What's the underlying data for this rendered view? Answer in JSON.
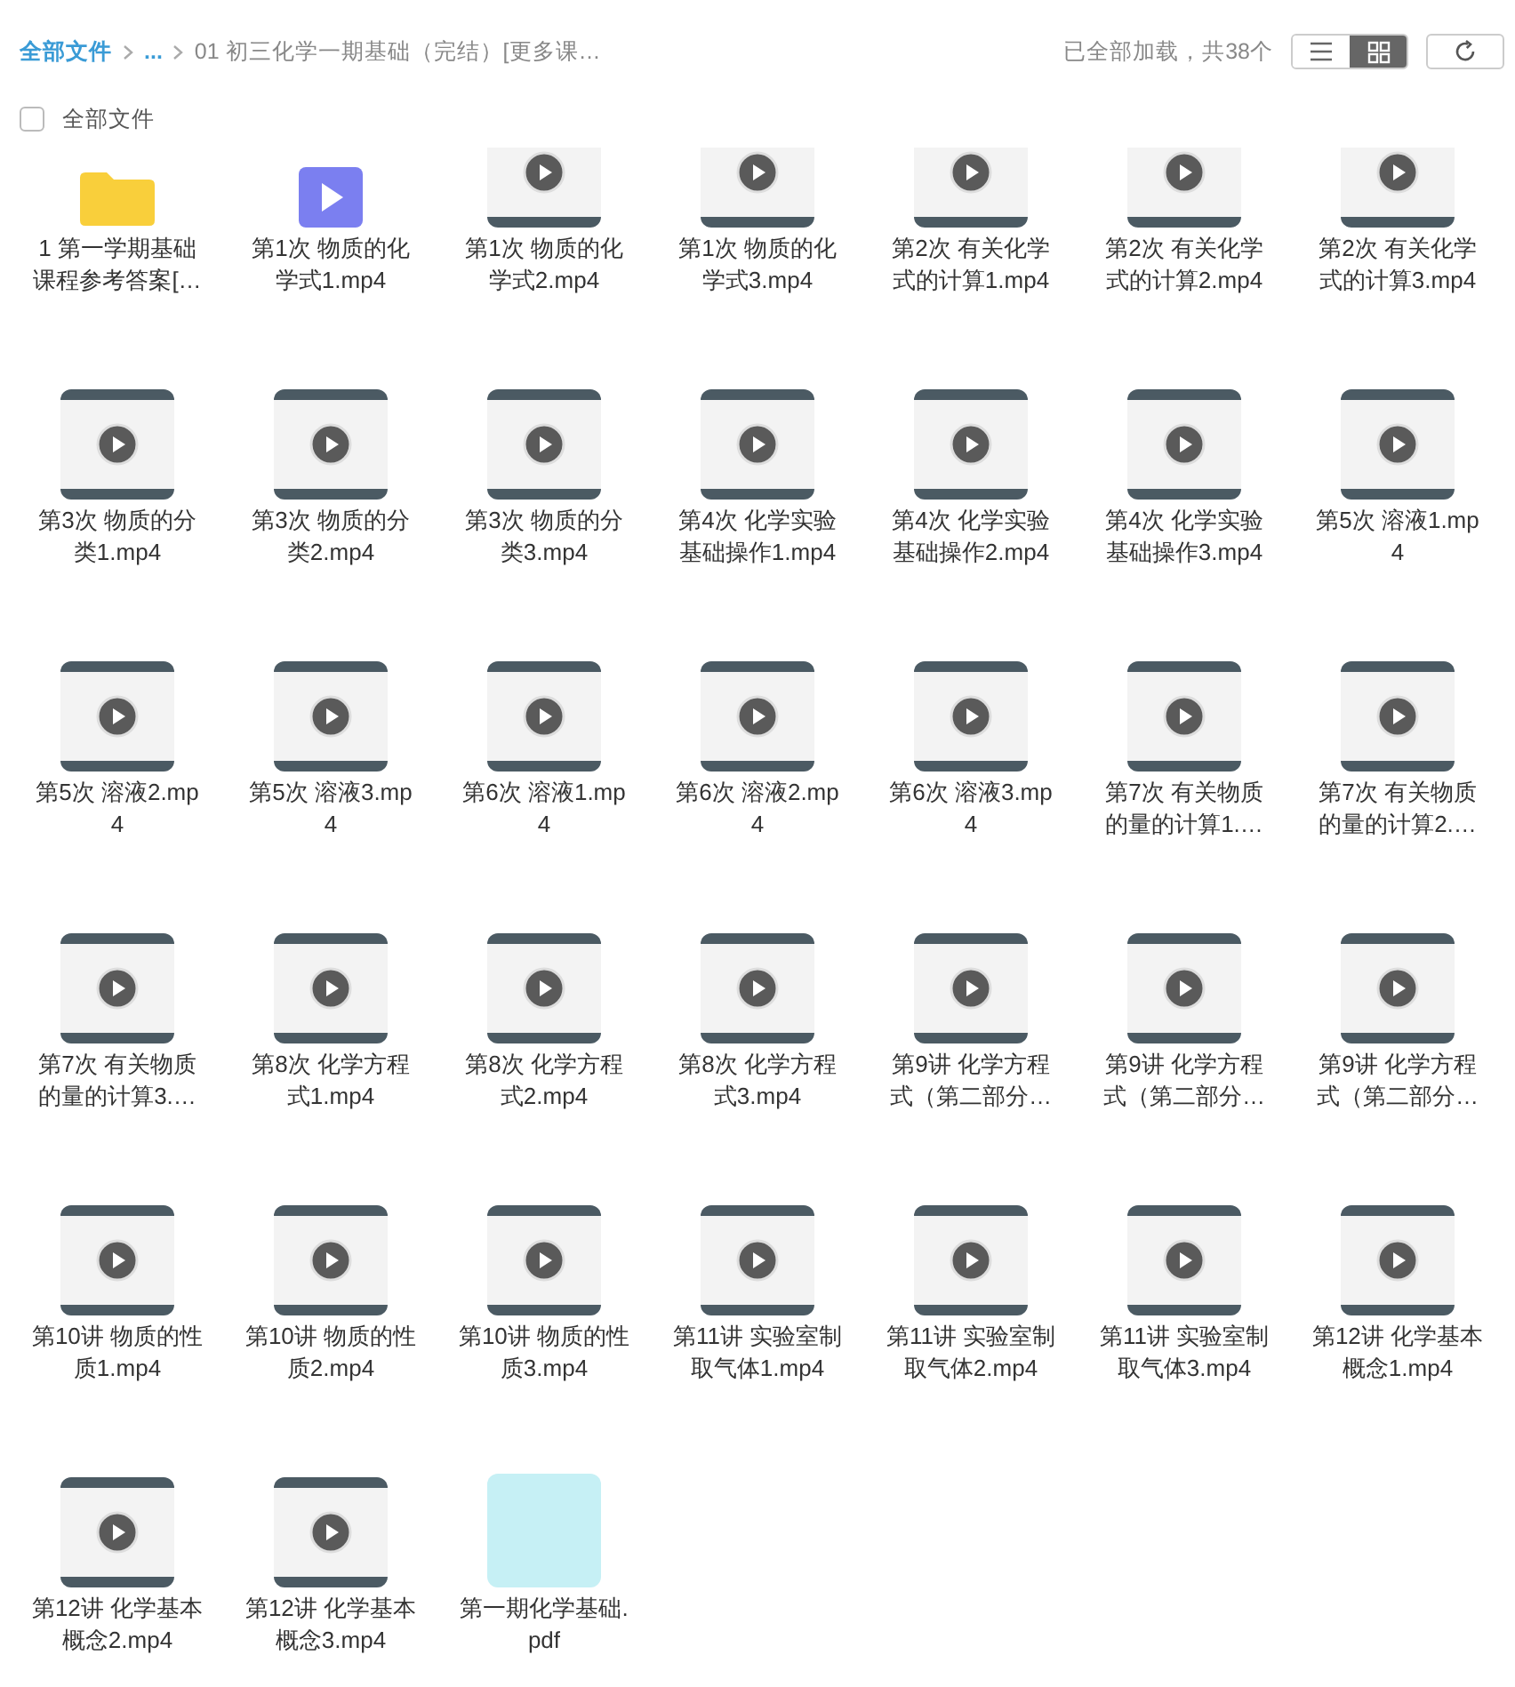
{
  "breadcrumb": [
    {
      "label": "全部文件"
    },
    {
      "label": "..."
    },
    {
      "label": "01 初三化学一期基础（完结）[更多课…"
    }
  ],
  "status": "已全部加载，共38个",
  "view_modes": [
    {
      "kind": "list",
      "selected": false
    },
    {
      "kind": "grid",
      "selected": true
    }
  ],
  "select_all": {
    "label": "全部文件",
    "checked": false
  },
  "files": [
    {
      "name": "1 第一学期基础课程参考答案[…",
      "kind": "folder"
    },
    {
      "name": "第1次 物质的化学式1.mp4",
      "kind": "video_file"
    },
    {
      "name": "第1次 物质的化学式2.mp4",
      "kind": "video"
    },
    {
      "name": "第1次 物质的化学式3.mp4",
      "kind": "video"
    },
    {
      "name": "第2次 有关化学式的计算1.mp4",
      "kind": "video"
    },
    {
      "name": "第2次 有关化学式的计算2.mp4",
      "kind": "video"
    },
    {
      "name": "第2次 有关化学式的计算3.mp4",
      "kind": "video"
    },
    {
      "name": "第3次 物质的分类1.mp4",
      "kind": "video"
    },
    {
      "name": "第3次 物质的分类2.mp4",
      "kind": "video"
    },
    {
      "name": "第3次 物质的分类3.mp4",
      "kind": "video"
    },
    {
      "name": "第4次 化学实验基础操作1.mp4",
      "kind": "video"
    },
    {
      "name": "第4次 化学实验基础操作2.mp4",
      "kind": "video"
    },
    {
      "name": "第4次 化学实验基础操作3.mp4",
      "kind": "video"
    },
    {
      "name": "第5次 溶液1.mp4",
      "kind": "video"
    },
    {
      "name": "第5次 溶液2.mp4",
      "kind": "video"
    },
    {
      "name": "第5次 溶液3.mp4",
      "kind": "video"
    },
    {
      "name": "第6次 溶液1.mp4",
      "kind": "video"
    },
    {
      "name": "第6次 溶液2.mp4",
      "kind": "video"
    },
    {
      "name": "第6次 溶液3.mp4",
      "kind": "video"
    },
    {
      "name": "第7次 有关物质的量的计算1.…",
      "kind": "video"
    },
    {
      "name": "第7次 有关物质的量的计算2.…",
      "kind": "video"
    },
    {
      "name": "第7次 有关物质的量的计算3.…",
      "kind": "video"
    },
    {
      "name": "第8次 化学方程式1.mp4",
      "kind": "video"
    },
    {
      "name": "第8次 化学方程式2.mp4",
      "kind": "video"
    },
    {
      "name": "第8次 化学方程式3.mp4",
      "kind": "video"
    },
    {
      "name": "第9讲 化学方程式（第二部分…",
      "kind": "video"
    },
    {
      "name": "第9讲 化学方程式（第二部分…",
      "kind": "video"
    },
    {
      "name": "第9讲 化学方程式（第二部分…",
      "kind": "video"
    },
    {
      "name": "第10讲 物质的性质1.mp4",
      "kind": "video"
    },
    {
      "name": "第10讲 物质的性质2.mp4",
      "kind": "video"
    },
    {
      "name": "第10讲 物质的性质3.mp4",
      "kind": "video"
    },
    {
      "name": "第11讲 实验室制取气体1.mp4",
      "kind": "video"
    },
    {
      "name": "第11讲 实验室制取气体2.mp4",
      "kind": "video"
    },
    {
      "name": "第11讲 实验室制取气体3.mp4",
      "kind": "video"
    },
    {
      "name": "第12讲 化学基本概念1.mp4",
      "kind": "video"
    },
    {
      "name": "第12讲 化学基本概念2.mp4",
      "kind": "video"
    },
    {
      "name": "第12讲 化学基本概念3.mp4",
      "kind": "video"
    },
    {
      "name": "第一期化学基础.pdf",
      "kind": "pdf"
    }
  ]
}
